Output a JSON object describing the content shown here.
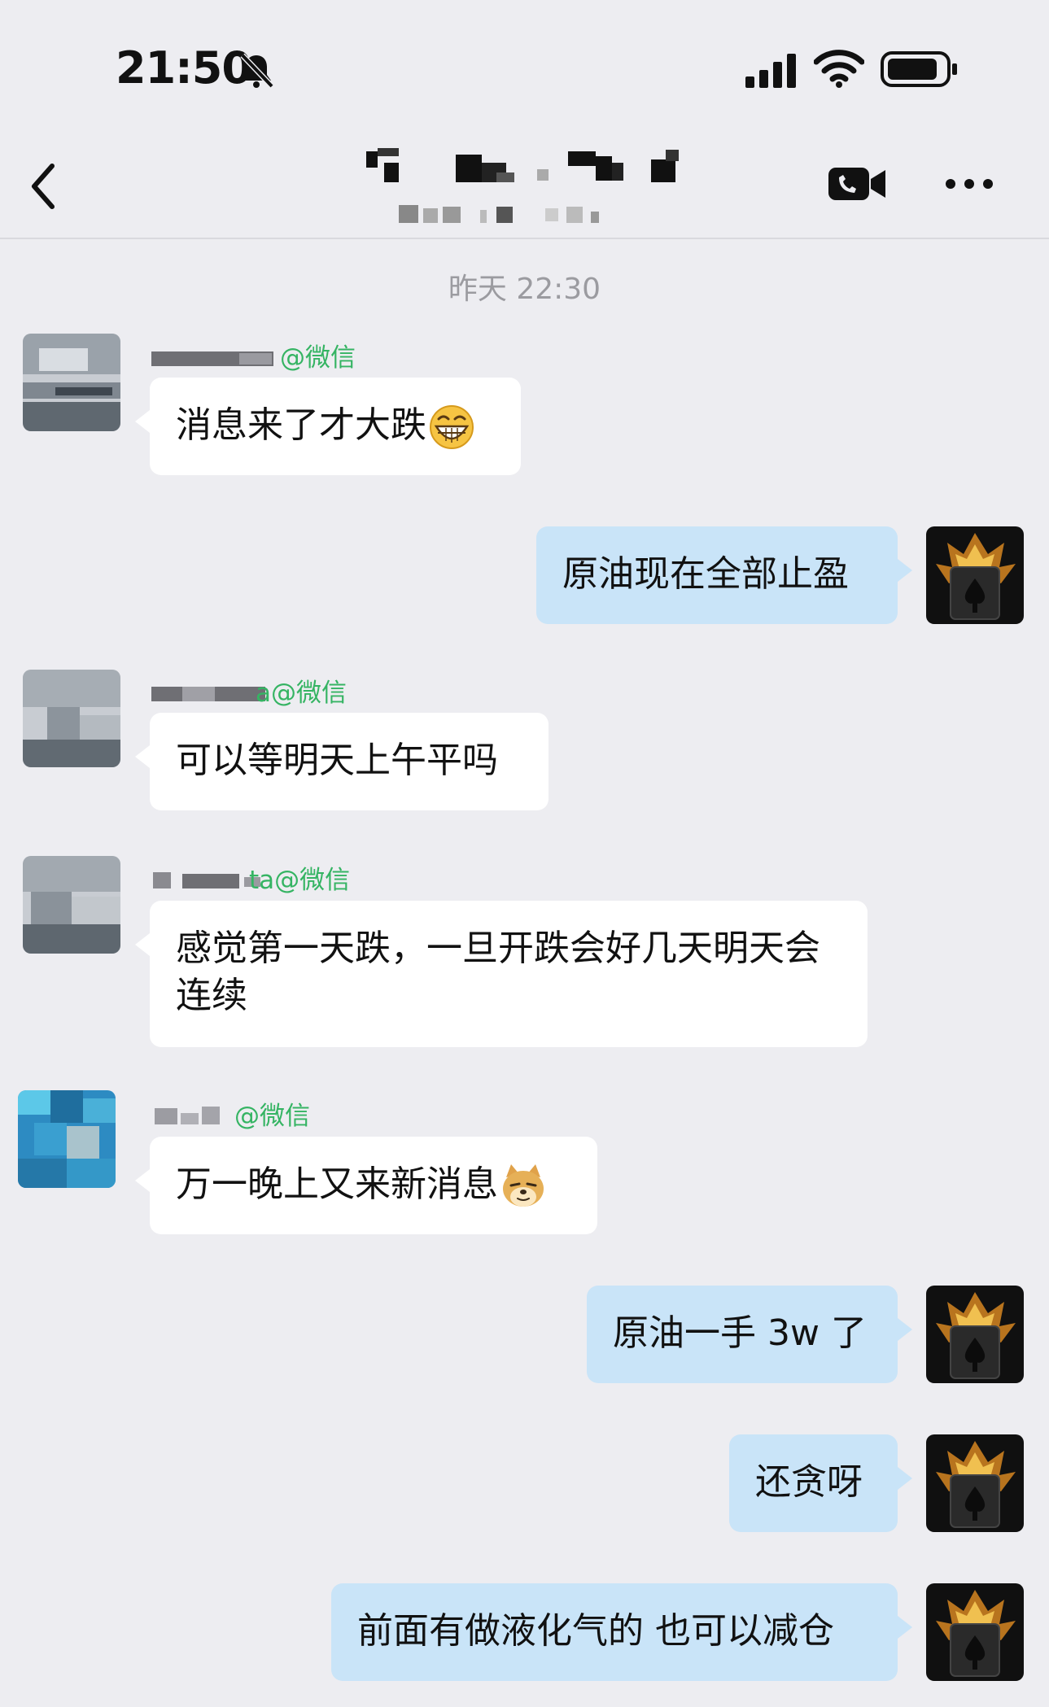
{
  "status_bar": {
    "time": "21:50",
    "icons": [
      "mute-bell-icon",
      "signal-icon",
      "wifi-icon",
      "battery-icon"
    ]
  },
  "header": {
    "title": "",
    "subtitle": "",
    "icons": [
      "back-icon",
      "video-call-icon",
      "more-icon"
    ]
  },
  "chat": {
    "timestamp": "昨天 22:30",
    "messages": [
      {
        "side": "in",
        "sender_visible": "@微信",
        "text": "消息来了才大跌",
        "emoji": "grinning-face-icon"
      },
      {
        "side": "out",
        "text": "原油现在全部止盈"
      },
      {
        "side": "in",
        "sender_visible": "a@微信",
        "text": "可以等明天上午平吗"
      },
      {
        "side": "in",
        "sender_visible": "ta@微信",
        "text": "感觉第一天跌，一旦开跌会好几天明天会连续"
      },
      {
        "side": "in",
        "sender_visible": "@微信",
        "text": "万一晚上又来新消息",
        "emoji": "doge-icon"
      },
      {
        "side": "out",
        "text": "原油一手 3w 了"
      },
      {
        "side": "out",
        "text": "还贪呀"
      },
      {
        "side": "out",
        "text": "前面有做液化气的 也可以减仓"
      }
    ]
  },
  "colors": {
    "background": "#ededf1",
    "incoming_bubble": "#ffffff",
    "outgoing_bubble": "#c9e4f8",
    "sender_label": "#35b463",
    "timestamp": "#9b9ba0"
  }
}
